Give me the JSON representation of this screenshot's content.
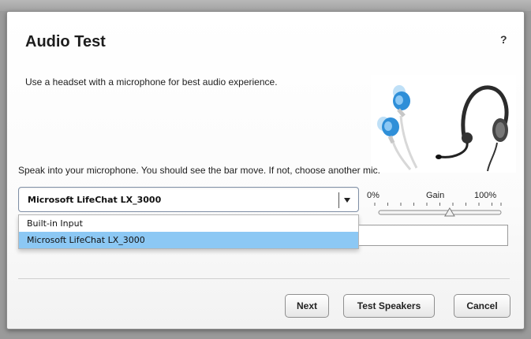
{
  "dialog": {
    "title": "Audio Test",
    "help_label": "?",
    "intro_text": "Use a headset with a microphone for best audio experience.",
    "instruction_text": "Speak into your microphone. You should see the bar move. If not, choose another mic."
  },
  "mic_select": {
    "selected": "Microsoft LifeChat LX_3000",
    "options": [
      "Built-in Input",
      "Microsoft LifeChat LX_3000"
    ],
    "highlighted_index": 1
  },
  "gain": {
    "label": "Gain",
    "min_label": "0%",
    "max_label": "100%",
    "value_percent": 58
  },
  "input_level_percent": 0,
  "buttons": {
    "next": "Next",
    "test_speakers": "Test Speakers",
    "cancel": "Cancel"
  },
  "colors": {
    "accent_highlight": "#8cc8f4",
    "earbud_blue": "#2f8fd8"
  },
  "icons": {
    "help": "question-mark-icon",
    "dropdown": "chevron-down-icon",
    "slider_thumb": "triangle-thumb-icon"
  }
}
